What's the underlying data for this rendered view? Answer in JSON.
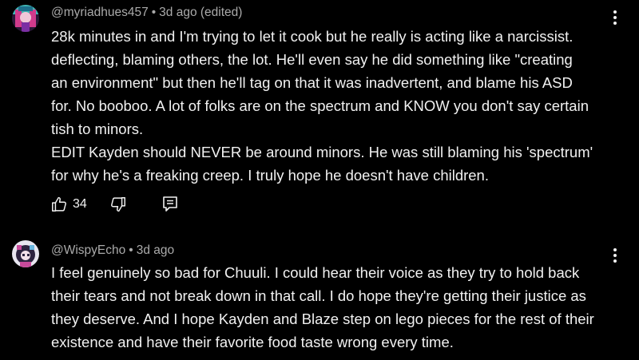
{
  "comments": [
    {
      "author": "@myriadhues457",
      "time": "3d ago",
      "edited": "(edited)",
      "lines": [
        "28k minutes in and I'm trying to let it cook but he really is acting like a narcissist.",
        "deflecting, blaming others, the lot. He'll even say he did something like \"creating",
        "an environment\" but then he'll tag on that it was inadvertent, and blame his ASD",
        "for. No booboo. A lot of folks are on the spectrum and KNOW you don't say certain",
        "tish to minors.",
        "EDIT Kayden should NEVER be around minors. He was still blaming his 'spectrum'",
        "for why he's a freaking creep. I truly hope he doesn't have children."
      ],
      "likes": "34",
      "avatar_colors": [
        "#3fb7b4",
        "#d13a8c",
        "#7b2fa3"
      ]
    },
    {
      "author": "@WispyEcho",
      "time": "3d ago",
      "lines": [
        "I feel genuinely so bad for Chuuli. I could hear their voice as they try to hold back",
        "their tears and not break down in that call. I do hope they're getting their justice as",
        "they deserve. And I hope Kayden and Blaze step on lego pieces for the rest of their",
        "existence and have their favorite food taste wrong every time."
      ],
      "avatar_colors": [
        "#e8e6f0",
        "#c84a9b",
        "#2d2440"
      ]
    }
  ],
  "separator": "•",
  "icons": {
    "like": "thumbs-up-icon",
    "dislike": "thumbs-down-icon",
    "reply": "reply-icon",
    "more": "more-vert-icon"
  },
  "colors": {
    "background": "#000000",
    "text": "#f1f1f1",
    "meta": "#aaaaaa"
  }
}
